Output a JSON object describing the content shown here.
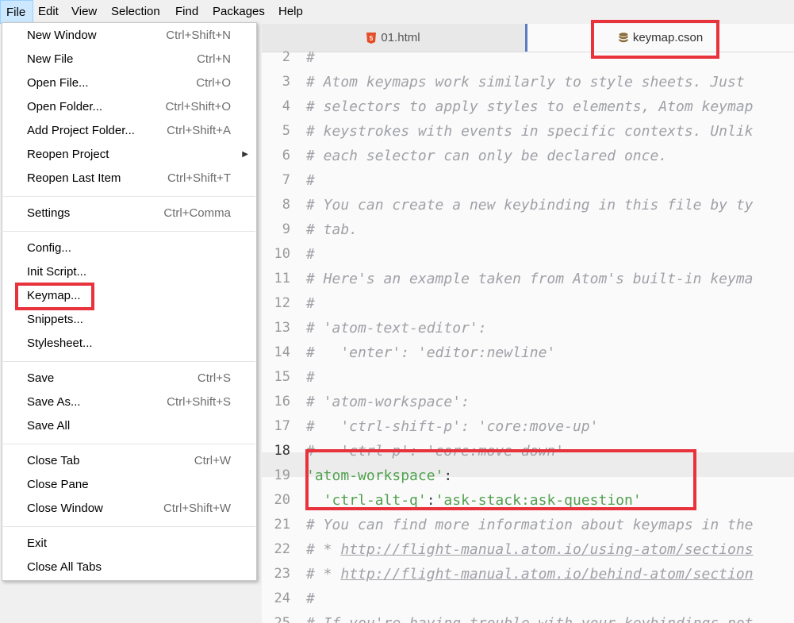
{
  "menubar": [
    "File",
    "Edit",
    "View",
    "Selection",
    "Find",
    "Packages",
    "Help"
  ],
  "file_menu": {
    "groups": [
      [
        {
          "label": "New Window",
          "shortcut": "Ctrl+Shift+N"
        },
        {
          "label": "New File",
          "shortcut": "Ctrl+N"
        },
        {
          "label": "Open File...",
          "shortcut": "Ctrl+O"
        },
        {
          "label": "Open Folder...",
          "shortcut": "Ctrl+Shift+O"
        },
        {
          "label": "Add Project Folder...",
          "shortcut": "Ctrl+Shift+A"
        },
        {
          "label": "Reopen Project",
          "shortcut": "",
          "submenu": true
        },
        {
          "label": "Reopen Last Item",
          "shortcut": "Ctrl+Shift+T"
        }
      ],
      [
        {
          "label": "Settings",
          "shortcut": "Ctrl+Comma"
        }
      ],
      [
        {
          "label": "Config...",
          "shortcut": ""
        },
        {
          "label": "Init Script...",
          "shortcut": ""
        },
        {
          "label": "Keymap...",
          "shortcut": "",
          "highlighted": true
        },
        {
          "label": "Snippets...",
          "shortcut": ""
        },
        {
          "label": "Stylesheet...",
          "shortcut": ""
        }
      ],
      [
        {
          "label": "Save",
          "shortcut": "Ctrl+S"
        },
        {
          "label": "Save As...",
          "shortcut": "Ctrl+Shift+S"
        },
        {
          "label": "Save All",
          "shortcut": ""
        }
      ],
      [
        {
          "label": "Close Tab",
          "shortcut": "Ctrl+W"
        },
        {
          "label": "Close Pane",
          "shortcut": ""
        },
        {
          "label": "Close Window",
          "shortcut": "Ctrl+Shift+W"
        }
      ],
      [
        {
          "label": "Exit",
          "shortcut": ""
        },
        {
          "label": "Close All Tabs",
          "shortcut": ""
        }
      ]
    ]
  },
  "tabs": [
    {
      "title": "01.html",
      "icon": "html5-icon",
      "active": false
    },
    {
      "title": "keymap.cson",
      "icon": "database-icon",
      "active": true
    }
  ],
  "editor": {
    "first_line_number": 2,
    "current_line": 18,
    "lines": [
      {
        "n": "2",
        "kind": "comment",
        "text": "#"
      },
      {
        "n": "3",
        "kind": "comment",
        "text": "# Atom keymaps work similarly to style sheets. Just"
      },
      {
        "n": "4",
        "kind": "comment",
        "text": "# selectors to apply styles to elements, Atom keymap"
      },
      {
        "n": "5",
        "kind": "comment",
        "text": "# keystrokes with events in specific contexts. Unlik"
      },
      {
        "n": "6",
        "kind": "comment",
        "text": "# each selector can only be declared once."
      },
      {
        "n": "7",
        "kind": "comment",
        "text": "#"
      },
      {
        "n": "8",
        "kind": "comment",
        "text": "# You can create a new keybinding in this file by ty"
      },
      {
        "n": "9",
        "kind": "comment",
        "text": "# tab."
      },
      {
        "n": "10",
        "kind": "comment",
        "text": "#"
      },
      {
        "n": "11",
        "kind": "comment",
        "text": "# Here's an example taken from Atom's built-in keyma"
      },
      {
        "n": "12",
        "kind": "comment",
        "text": "#"
      },
      {
        "n": "13",
        "kind": "comment",
        "text": "# 'atom-text-editor':"
      },
      {
        "n": "14",
        "kind": "comment",
        "text": "#   'enter': 'editor:newline'"
      },
      {
        "n": "15",
        "kind": "comment",
        "text": "#"
      },
      {
        "n": "16",
        "kind": "comment",
        "text": "# 'atom-workspace':"
      },
      {
        "n": "17",
        "kind": "comment",
        "text": "#   'ctrl-shift-p': 'core:move-up'"
      },
      {
        "n": "18",
        "kind": "comment",
        "text": "#   'ctrl-p': 'core:move-down'"
      },
      {
        "n": "19",
        "kind": "code",
        "parts": [
          {
            "t": "'atom-workspace'",
            "c": "str"
          },
          {
            "t": ":",
            "c": "punc"
          }
        ]
      },
      {
        "n": "20",
        "kind": "code",
        "parts": [
          {
            "t": "  ",
            "c": "punc"
          },
          {
            "t": "'ctrl-alt-q'",
            "c": "str"
          },
          {
            "t": ":",
            "c": "punc"
          },
          {
            "t": "'ask-stack:ask-question'",
            "c": "str"
          }
        ]
      },
      {
        "n": "21",
        "kind": "comment",
        "text": "# You can find more information about keymaps in the"
      },
      {
        "n": "22",
        "kind": "comment",
        "prefix": "# * ",
        "link": "http://flight-manual.atom.io/using-atom/sections"
      },
      {
        "n": "23",
        "kind": "comment",
        "prefix": "# * ",
        "link": "http://flight-manual.atom.io/behind-atom/section"
      },
      {
        "n": "24",
        "kind": "comment",
        "text": "#"
      },
      {
        "n": "25",
        "kind": "comment",
        "text": "# If you're having trouble with your keybindings not"
      }
    ]
  },
  "colors": {
    "highlight_box": "#e8323c",
    "string": "#50a14f",
    "comment": "#a0a1a7",
    "active_tab_border": "#5b7cc2",
    "html5_icon": "#e44d26",
    "database_icon": "#8a6d3b"
  }
}
